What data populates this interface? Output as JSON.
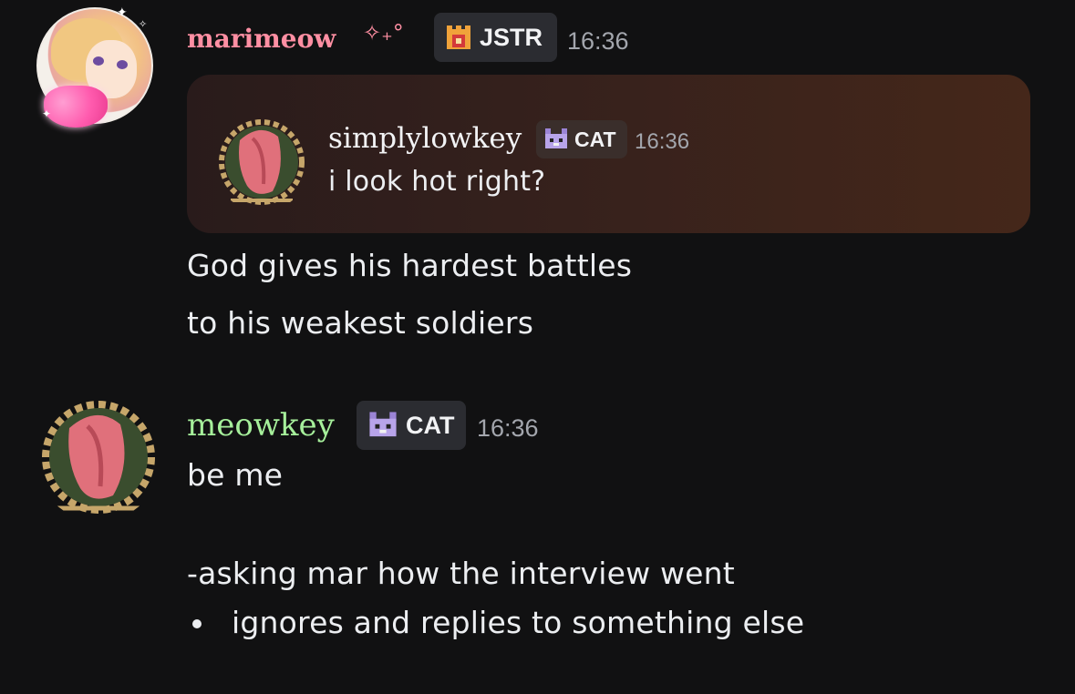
{
  "messages": [
    {
      "author": "marimeow",
      "author_suffix": "✧₊°",
      "author_color": "#ff8fa3",
      "tag": "JSTR",
      "tag_icon": "castle-icon",
      "time": "16:36",
      "reply": {
        "author": "simplylowkey",
        "tag": "CAT",
        "tag_icon": "pixel-cat-icon",
        "time": "16:36",
        "text": "i look hot right?"
      },
      "lines": [
        "God gives his hardest battles",
        "to his weakest soldiers"
      ]
    },
    {
      "author": "meowkey",
      "author_color": "#a6ef9b",
      "tag": "CAT",
      "tag_icon": "pixel-cat-icon",
      "time": "16:36",
      "lines": [
        "be me",
        "-asking mar how the interview went"
      ],
      "bullets": [
        "ignores and replies to something else"
      ]
    }
  ]
}
